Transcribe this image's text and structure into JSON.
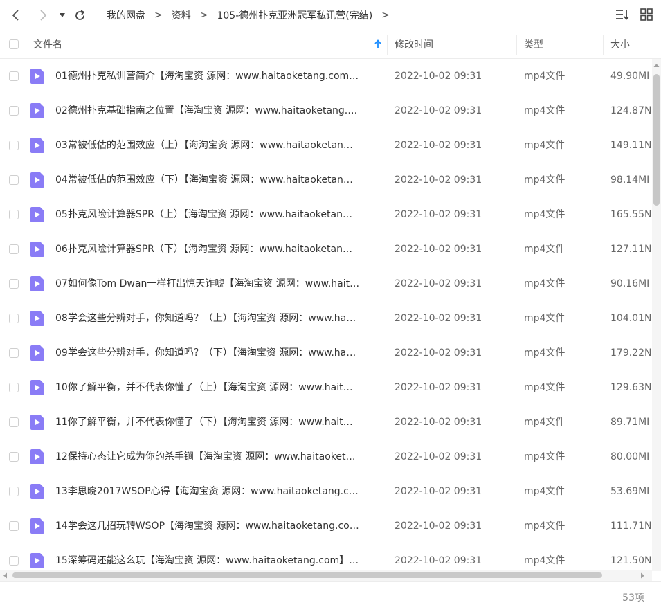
{
  "toolbar": {
    "back_icon": "chevron-left-icon",
    "forward_icon": "chevron-right-icon",
    "history_icon": "caret-down-icon",
    "refresh_icon": "refresh-icon"
  },
  "breadcrumb": [
    "我的网盘",
    "资料",
    "105-德州扑克亚洲冠军私讯营(完结)"
  ],
  "breadcrumb_sep": ">",
  "header": {
    "name": "文件名",
    "modified": "修改时间",
    "type": "类型",
    "size": "大小"
  },
  "files": [
    {
      "name": "01德州扑克私训营简介【海淘宝资 源网：www.haitaoketang.com…",
      "time": "2022-10-02 09:31",
      "type": "mp4文件",
      "size": "49.90MI"
    },
    {
      "name": "02德州扑克基础指南之位置【海淘宝资 源网：www.haitaoketang.…",
      "time": "2022-10-02 09:31",
      "type": "mp4文件",
      "size": "124.87N"
    },
    {
      "name": "03常被低估的范围效应（上）【海淘宝资 源网：www.haitaoketan…",
      "time": "2022-10-02 09:31",
      "type": "mp4文件",
      "size": "149.11N"
    },
    {
      "name": "04常被低估的范围效应（下）【海淘宝资 源网：www.haitaoketan…",
      "time": "2022-10-02 09:31",
      "type": "mp4文件",
      "size": "98.14MI"
    },
    {
      "name": "05扑克风险计算器SPR（上）【海淘宝资 源网：www.haitaoketan…",
      "time": "2022-10-02 09:31",
      "type": "mp4文件",
      "size": "165.55N"
    },
    {
      "name": "06扑克风险计算器SPR（下）【海淘宝资 源网：www.haitaoketan…",
      "time": "2022-10-02 09:31",
      "type": "mp4文件",
      "size": "127.11N"
    },
    {
      "name": "07如何像Tom Dwan一样打出惊天诈唬【海淘宝资 源网：www.hait…",
      "time": "2022-10-02 09:31",
      "type": "mp4文件",
      "size": "90.16MI"
    },
    {
      "name": "08学会这些分辨对手，你知道吗？（上）【海淘宝资 源网：www.ha…",
      "time": "2022-10-02 09:31",
      "type": "mp4文件",
      "size": "104.01N"
    },
    {
      "name": "09学会这些分辨对手，你知道吗？（下）【海淘宝资 源网：www.ha…",
      "time": "2022-10-02 09:31",
      "type": "mp4文件",
      "size": "179.22N"
    },
    {
      "name": "10你了解平衡，并不代表你懂了（上）【海淘宝资 源网：www.hait…",
      "time": "2022-10-02 09:31",
      "type": "mp4文件",
      "size": "129.63N"
    },
    {
      "name": "11你了解平衡，并不代表你懂了（下）【海淘宝资 源网：www.hait…",
      "time": "2022-10-02 09:31",
      "type": "mp4文件",
      "size": "89.71MI"
    },
    {
      "name": "12保持心态让它成为你的杀手锏【海淘宝资 源网：www.haitaoket…",
      "time": "2022-10-02 09:31",
      "type": "mp4文件",
      "size": "80.00MI"
    },
    {
      "name": "13李思晓2017WSOP心得【海淘宝资 源网：www.haitaoketang.c…",
      "time": "2022-10-02 09:31",
      "type": "mp4文件",
      "size": "53.69MI"
    },
    {
      "name": "14学会这几招玩转WSOP【海淘宝资 源网：www.haitaoketang.co…",
      "time": "2022-10-02 09:31",
      "type": "mp4文件",
      "size": "111.71N"
    },
    {
      "name": "15深筹码还能这么玩【海淘宝资 源网：www.haitaoketang.com】…",
      "time": "2022-10-02 09:31",
      "type": "mp4文件",
      "size": "121.50N"
    }
  ],
  "file_icon": "video-file-icon",
  "footer": {
    "count": "53项"
  },
  "colors": {
    "accent": "#1a8cff",
    "file_icon": "#8a7cf6"
  }
}
